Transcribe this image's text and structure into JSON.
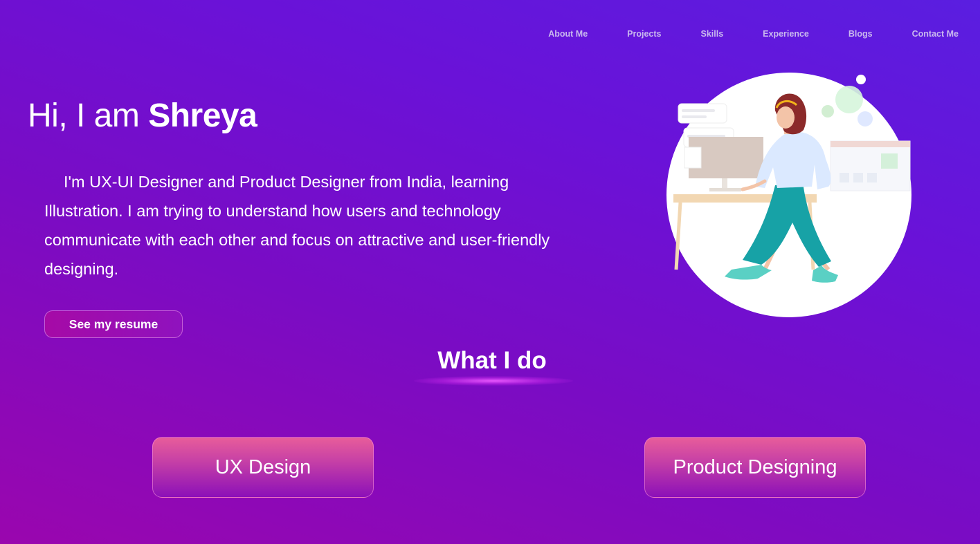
{
  "nav": {
    "items": [
      "About Me",
      "Projects",
      "Skills",
      "Experience",
      "Blogs",
      "Contact Me"
    ]
  },
  "hero": {
    "greeting": "Hi, I am",
    "name": "Shreya",
    "bio": "I'm UX-UI Designer and Product Designer from India, learning Illustration. I am trying to understand how users and technology communicate with each other and focus on attractive and user-friendly designing.",
    "resume_label": "See my resume",
    "illustration_icon": "walking-woman-illustration"
  },
  "what_i_do": {
    "title": "What I do",
    "cards": [
      "UX Design",
      "Product Designing"
    ]
  },
  "colors": {
    "bg_top": "#5a1ee0",
    "bg_bottom": "#9a06ae",
    "nav_text": "#c9b8ee",
    "card_top": "#e85d9a",
    "card_bottom": "#8c10b8",
    "accent_teal": "#17a2a6"
  }
}
